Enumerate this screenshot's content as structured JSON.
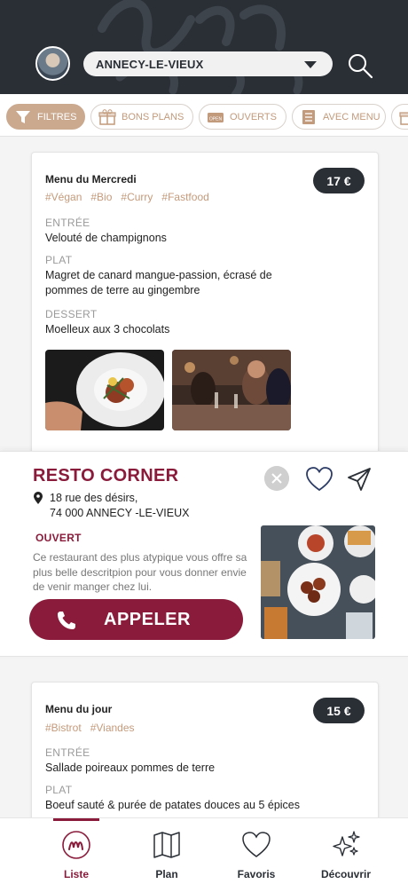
{
  "header": {
    "city": "ANNECY-LE-VIEUX"
  },
  "filters": [
    {
      "label": "FILTRES",
      "icon": "filter-icon",
      "active": true
    },
    {
      "label": "BONS PLANS",
      "icon": "gift-icon",
      "active": false
    },
    {
      "label": "OUVERTS",
      "icon": "open-sign-icon",
      "active": false
    },
    {
      "label": "AVEC MENU",
      "icon": "menu-list-icon",
      "active": false
    }
  ],
  "menus": [
    {
      "title": "Menu du Mercredi",
      "price": "17 €",
      "tags": [
        "#Végan",
        "#Bio",
        "#Curry",
        "#Fastfood"
      ],
      "sections": [
        {
          "label": "ENTRÉE",
          "text": "Velouté de champignons"
        },
        {
          "label": "PLAT",
          "text": "Magret de canard mangue-passion, écrasé de pommes de terre au gingembre"
        },
        {
          "label": "DESSERT",
          "text": "Moelleux aux 3 chocolats"
        }
      ]
    },
    {
      "title": "Menu du jour",
      "price": "15 €",
      "tags": [
        "#Bistrot",
        "#Viandes"
      ],
      "sections": [
        {
          "label": "ENTRÉE",
          "text": "Sallade poireaux pommes de terre"
        },
        {
          "label": "PLAT",
          "text": "Boeuf sauté & purée de patates douces au 5 épices"
        }
      ]
    }
  ],
  "restaurant": {
    "name": "RESTO CORNER",
    "address_line1": "18 rue des désirs,",
    "address_line2": "74 000 ANNECY -LE-VIEUX",
    "status": "OUVERT",
    "description": "Ce restaurant des plus atypique vous offre sa plus belle descritpion pour vous donner envie de venir manger chez lui.",
    "call_label": "APPELER"
  },
  "nav": [
    {
      "label": "Liste",
      "icon": "liste-logo-icon",
      "active": true
    },
    {
      "label": "Plan",
      "icon": "map-icon",
      "active": false
    },
    {
      "label": "Favoris",
      "icon": "heart-icon",
      "active": false
    },
    {
      "label": "Découvrir",
      "icon": "sparkles-icon",
      "active": false
    }
  ],
  "colors": {
    "brand": "#8a1b3b",
    "accent": "#caa98f",
    "dark": "#2a2f36"
  }
}
